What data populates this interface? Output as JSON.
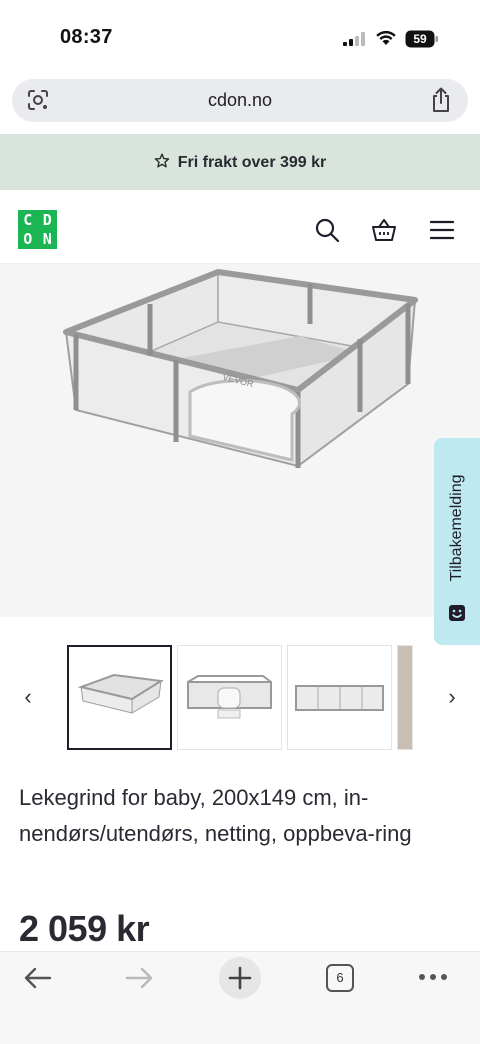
{
  "status": {
    "time": "08:37",
    "battery": "59"
  },
  "browser": {
    "url": "cdon.no",
    "open_tabs": "6",
    "icons": [
      "google-lens-icon",
      "share-icon",
      "back-arrow-icon",
      "forward-arrow-icon",
      "plus-icon",
      "tabs-icon",
      "more-dots-icon"
    ]
  },
  "promo": {
    "text": "Fri frakt over 399 kr"
  },
  "header": {
    "logo_letters": [
      "C",
      "D",
      "O",
      "N"
    ],
    "brand_color": "#1bb553"
  },
  "product": {
    "brand_on_image": "VEVOR",
    "title": "Lekegrind for baby, 200x149 cm, in-nendørs/utendørs, netting, oppbeva-ring",
    "price": "2 059 kr",
    "thumbnail_count_visible": 4,
    "active_thumbnail": 1
  },
  "feedback": {
    "label": "Tilbakemelding",
    "color": "#bfe9f1"
  },
  "colors": {
    "promo_bg": "#d9e5dc",
    "text_dark": "#2b2a33"
  }
}
